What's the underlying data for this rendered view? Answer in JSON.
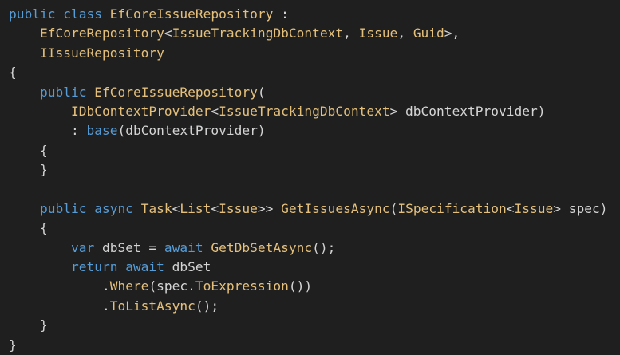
{
  "editor": {
    "colors": {
      "background": "#1f1f1f",
      "keyword": "#569cd6",
      "type": "#e5c07b",
      "method": "#e5c07b",
      "plain": "#d4d4d4"
    },
    "lines": [
      [
        {
          "t": "public class ",
          "k": "keyword"
        },
        {
          "t": "EfCoreIssueRepository",
          "k": "type"
        },
        {
          "t": " :",
          "k": "plain"
        }
      ],
      [
        {
          "t": "    ",
          "k": "plain"
        },
        {
          "t": "EfCoreRepository",
          "k": "type"
        },
        {
          "t": "<",
          "k": "punct"
        },
        {
          "t": "IssueTrackingDbContext",
          "k": "type"
        },
        {
          "t": ", ",
          "k": "plain"
        },
        {
          "t": "Issue",
          "k": "type"
        },
        {
          "t": ", ",
          "k": "plain"
        },
        {
          "t": "Guid",
          "k": "type"
        },
        {
          "t": ">,",
          "k": "punct"
        }
      ],
      [
        {
          "t": "    ",
          "k": "plain"
        },
        {
          "t": "IIssueRepository",
          "k": "type"
        }
      ],
      [
        {
          "t": "{",
          "k": "plain"
        }
      ],
      [
        {
          "t": "    ",
          "k": "plain"
        },
        {
          "t": "public ",
          "k": "keyword"
        },
        {
          "t": "EfCoreIssueRepository",
          "k": "type"
        },
        {
          "t": "(",
          "k": "punct"
        }
      ],
      [
        {
          "t": "        ",
          "k": "plain"
        },
        {
          "t": "IDbContextProvider",
          "k": "type"
        },
        {
          "t": "<",
          "k": "punct"
        },
        {
          "t": "IssueTrackingDbContext",
          "k": "type"
        },
        {
          "t": "> dbContextProvider)",
          "k": "plain"
        }
      ],
      [
        {
          "t": "        : ",
          "k": "plain"
        },
        {
          "t": "base",
          "k": "keyword"
        },
        {
          "t": "(dbContextProvider)",
          "k": "plain"
        }
      ],
      [
        {
          "t": "    {",
          "k": "plain"
        }
      ],
      [
        {
          "t": "    }",
          "k": "plain"
        }
      ],
      [
        {
          "t": "",
          "k": "plain"
        }
      ],
      [
        {
          "t": "    ",
          "k": "plain"
        },
        {
          "t": "public async ",
          "k": "keyword"
        },
        {
          "t": "Task",
          "k": "type"
        },
        {
          "t": "<",
          "k": "punct"
        },
        {
          "t": "List",
          "k": "type"
        },
        {
          "t": "<",
          "k": "punct"
        },
        {
          "t": "Issue",
          "k": "type"
        },
        {
          "t": ">> ",
          "k": "punct"
        },
        {
          "t": "GetIssuesAsync",
          "k": "method"
        },
        {
          "t": "(",
          "k": "punct"
        },
        {
          "t": "ISpecification",
          "k": "type"
        },
        {
          "t": "<",
          "k": "punct"
        },
        {
          "t": "Issue",
          "k": "type"
        },
        {
          "t": "> spec)",
          "k": "plain"
        }
      ],
      [
        {
          "t": "    {",
          "k": "plain"
        }
      ],
      [
        {
          "t": "        ",
          "k": "plain"
        },
        {
          "t": "var ",
          "k": "keyword"
        },
        {
          "t": "dbSet = ",
          "k": "plain"
        },
        {
          "t": "await ",
          "k": "keyword"
        },
        {
          "t": "GetDbSetAsync",
          "k": "method"
        },
        {
          "t": "();",
          "k": "plain"
        }
      ],
      [
        {
          "t": "        ",
          "k": "plain"
        },
        {
          "t": "return await ",
          "k": "keyword"
        },
        {
          "t": "dbSet",
          "k": "plain"
        }
      ],
      [
        {
          "t": "            .",
          "k": "plain"
        },
        {
          "t": "Where",
          "k": "method"
        },
        {
          "t": "(spec.",
          "k": "plain"
        },
        {
          "t": "ToExpression",
          "k": "method"
        },
        {
          "t": "())",
          "k": "plain"
        }
      ],
      [
        {
          "t": "            .",
          "k": "plain"
        },
        {
          "t": "ToListAsync",
          "k": "method"
        },
        {
          "t": "();",
          "k": "plain"
        }
      ],
      [
        {
          "t": "    }",
          "k": "plain"
        }
      ],
      [
        {
          "t": "}",
          "k": "plain"
        }
      ]
    ]
  }
}
